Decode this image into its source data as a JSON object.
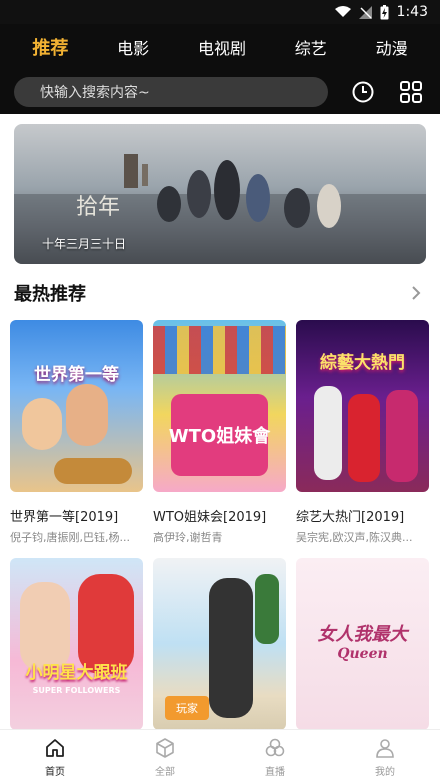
{
  "status_bar": {
    "time": "1:43"
  },
  "top_tabs": [
    {
      "label": "推荐",
      "active": true
    },
    {
      "label": "电影",
      "active": false
    },
    {
      "label": "电视剧",
      "active": false
    },
    {
      "label": "综艺",
      "active": false
    },
    {
      "label": "动漫",
      "active": false
    }
  ],
  "search": {
    "placeholder": "快输入搜索内容~"
  },
  "icons": {
    "history": "clock-icon",
    "categories": "grid-icon",
    "more": "chevron-right-icon"
  },
  "banner": {
    "caption": "十年三月三十日"
  },
  "section": {
    "title": "最热推荐"
  },
  "cards": [
    {
      "title": "世界第一等[2019]",
      "cast": "倪子钧,唐振刚,巴钰,杨...",
      "poster_text": "世界第一等"
    },
    {
      "title": "WTO姐妹会[2019]",
      "cast": "高伊玲,谢哲青",
      "poster_text": "WTO姐妹會"
    },
    {
      "title": "综艺大热门[2019]",
      "cast": "吴宗宪,欧汉声,陈汉典...",
      "poster_text": "綜藝大熱門"
    },
    {
      "title": "",
      "cast": "",
      "poster_text": "小明星大跟班"
    },
    {
      "title": "",
      "cast": "",
      "poster_text": "玩家"
    },
    {
      "title": "",
      "cast": "",
      "poster_text": "女人我最大"
    }
  ],
  "poster_sub": {
    "super_followers": "SUPER FOLLOWERS",
    "queen": "Queen"
  },
  "bottom_nav": [
    {
      "label": "首页",
      "icon": "home-icon",
      "active": true
    },
    {
      "label": "全部",
      "icon": "cube-icon",
      "active": false
    },
    {
      "label": "直播",
      "icon": "live-icon",
      "active": false
    },
    {
      "label": "我的",
      "icon": "user-icon",
      "active": false
    }
  ],
  "colors": {
    "accent": "#f2b233",
    "header_bg": "#0d0d0d"
  }
}
